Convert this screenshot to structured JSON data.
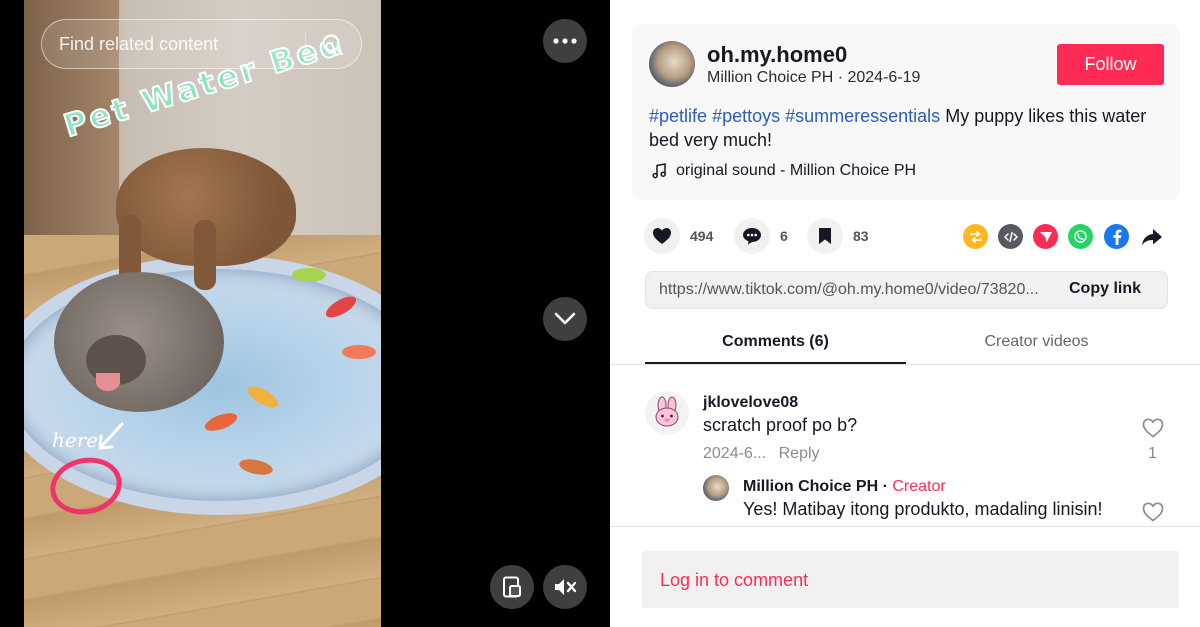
{
  "video": {
    "search_placeholder": "Find related content",
    "overlay_title": "Pet Water Bed",
    "overlay_here": "here",
    "icons": {
      "search": "search-icon",
      "more": "more-horizontal-icon",
      "next": "chevron-down-icon",
      "pip": "picture-in-picture-icon",
      "mute": "volume-muted-icon"
    }
  },
  "post": {
    "author_name": "oh.my.home0",
    "author_sub": "Million Choice PH · 2024-6-19",
    "follow_label": "Follow",
    "hashtags": [
      "#petlife",
      "#pettoys",
      "#summeressentials"
    ],
    "caption_text": "My puppy likes this water bed very much!",
    "music": "original sound - Million Choice PH",
    "accent_color": "#fe2c55",
    "hashtag_color": "#2b5db9"
  },
  "actions": {
    "likes": "494",
    "comments": "6",
    "saves": "83",
    "share_icons": [
      "repost-icon",
      "embed-icon",
      "send-icon",
      "whatsapp-icon",
      "facebook-icon",
      "share-arrow-icon"
    ]
  },
  "link": {
    "url": "https://www.tiktok.com/@oh.my.home0/video/73820...",
    "copy_label": "Copy link"
  },
  "tabs": {
    "comments_label": "Comments (6)",
    "creator_label": "Creator videos"
  },
  "comments": [
    {
      "user": "jklovelove08",
      "text": "scratch proof po b?",
      "date": "2024-6...",
      "reply_label": "Reply",
      "like_count": "1"
    },
    {
      "user": "Million Choice PH",
      "separator": " · ",
      "badge": "Creator",
      "text": "Yes! Matibay itong produkto, madaling linisin!"
    }
  ],
  "login": {
    "label": "Log in to comment"
  }
}
